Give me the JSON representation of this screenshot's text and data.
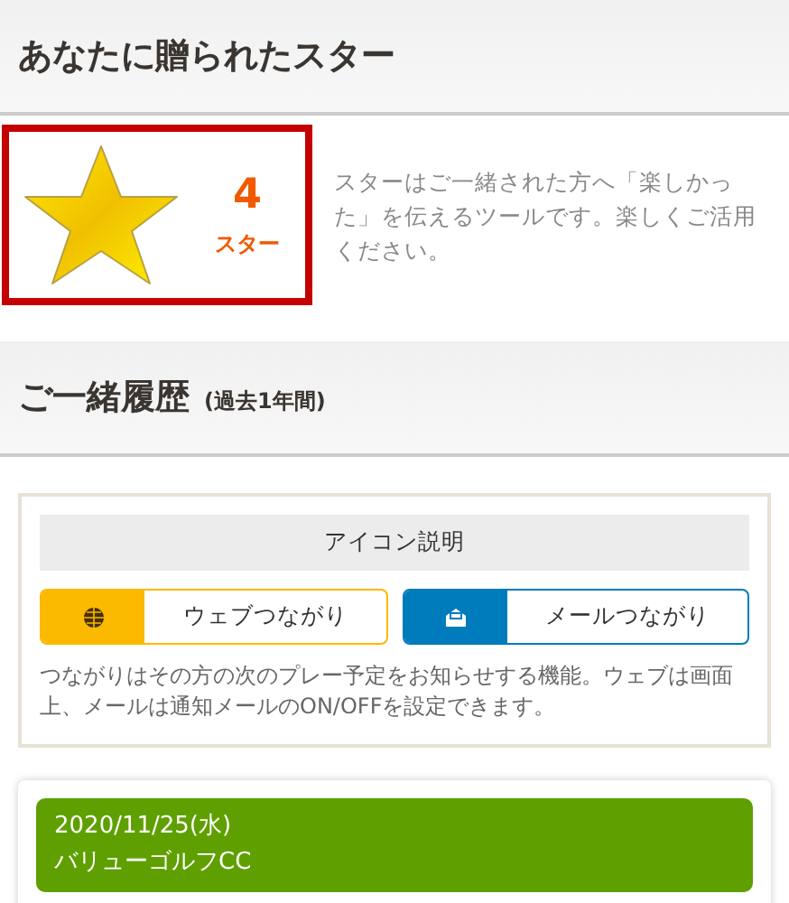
{
  "stars_section": {
    "title": "あなたに贈られたスター",
    "count": "4",
    "unit": "スター",
    "description": "スターはご一緒された方へ「楽しかった」を伝えるツールです。楽しくご活用ください。"
  },
  "history_section": {
    "title": "ご一緒履歴",
    "subtitle": "(過去1年間)"
  },
  "legend": {
    "title": "アイコン説明",
    "items": [
      {
        "kind": "web",
        "label": "ウェブつながり",
        "color": "#fbb900"
      },
      {
        "kind": "mail",
        "label": "メールつながり",
        "color": "#007bbb"
      }
    ],
    "note": "つながりはその方の次のプレー予定をお知らせする機能。ウェブは画面上、メールは通知メールのON/OFFを設定できます。"
  },
  "rounds": [
    {
      "date": "2020/11/25(水)",
      "course": "バリューゴルフCC"
    }
  ]
}
